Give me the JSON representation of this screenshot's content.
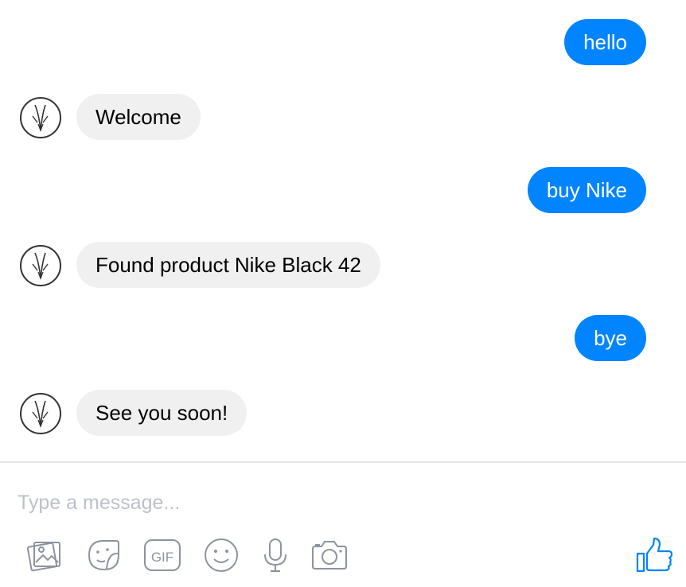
{
  "messages": [
    {
      "from": "me",
      "text": "hello"
    },
    {
      "from": "bot",
      "text": "Welcome"
    },
    {
      "from": "me",
      "text": "buy Nike"
    },
    {
      "from": "bot",
      "text": "Found product Nike Black 42"
    },
    {
      "from": "me",
      "text": "bye"
    },
    {
      "from": "bot",
      "text": "See you soon!"
    }
  ],
  "composer": {
    "placeholder": "Type a message...",
    "tools": [
      "image-icon",
      "sticker-icon",
      "gif-icon",
      "emoji-icon",
      "microphone-icon",
      "camera-icon"
    ],
    "gif_label": "GIF",
    "send": "like-thumbs-up-icon"
  },
  "colors": {
    "outgoing_bubble": "#0084ff",
    "incoming_bubble": "#f1f0f0",
    "icon_gray": "#8d949e",
    "like_blue": "#0084ff"
  }
}
